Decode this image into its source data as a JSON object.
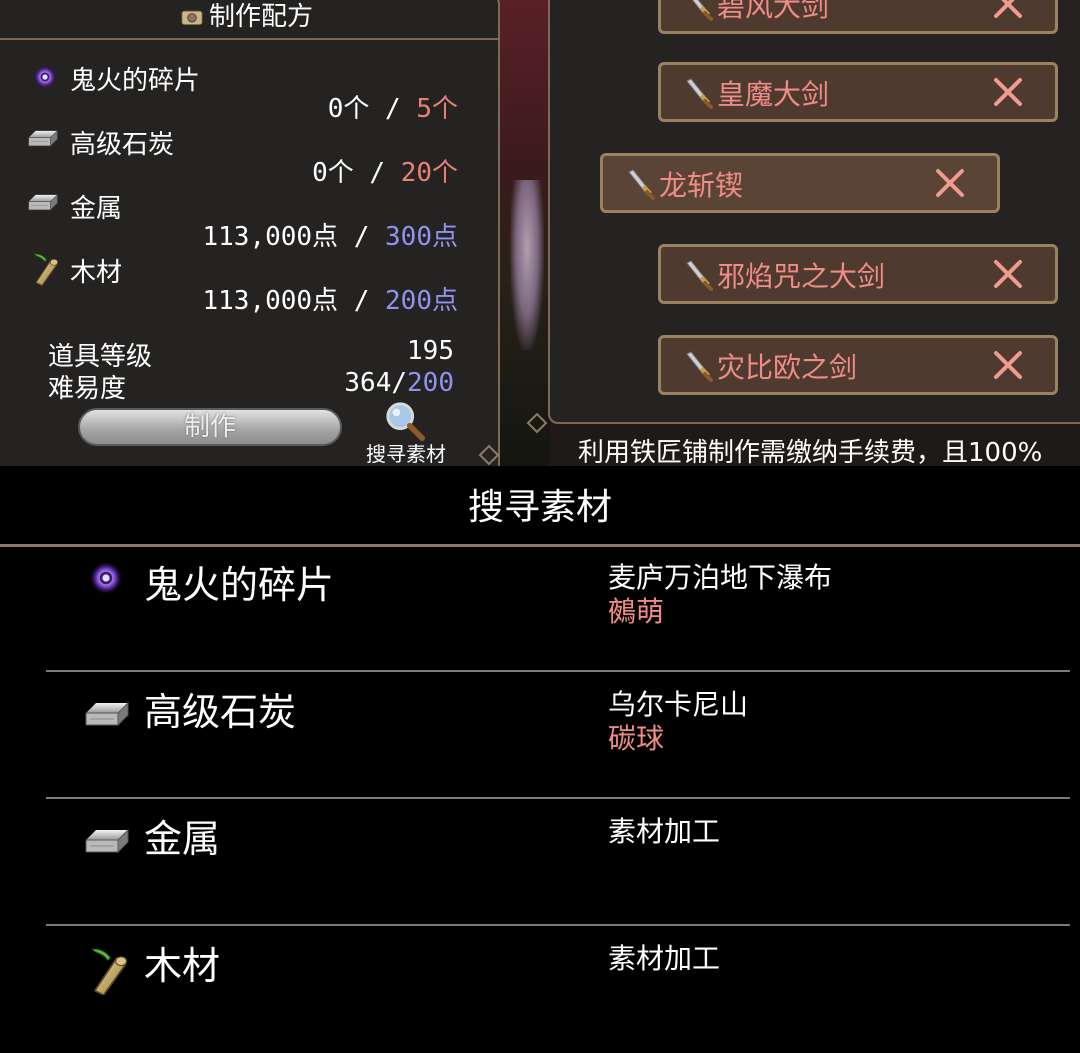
{
  "recipe": {
    "title": "制作配方",
    "materials": [
      {
        "name": "鬼火的碎片",
        "icon": "wisp-orb-icon",
        "have": "0个",
        "sep": " / ",
        "need": "5个",
        "need_color": "red"
      },
      {
        "name": "高级石炭",
        "icon": "coal-ingot-icon",
        "have": "0个",
        "sep": " / ",
        "need": "20个",
        "need_color": "red"
      },
      {
        "name": "金属",
        "icon": "metal-ingot-icon",
        "have": "113,000点",
        "sep": " / ",
        "need": "300点",
        "need_color": "blue"
      },
      {
        "name": "木材",
        "icon": "wood-log-icon",
        "have": "113,000点",
        "sep": " / ",
        "need": "200点",
        "need_color": "blue"
      }
    ],
    "item_level_label": "道具等级",
    "item_level_value": "195",
    "difficulty_label": "难易度",
    "difficulty_value": "364/",
    "difficulty_max": "200",
    "craft_button": "制作",
    "search_button": "搜寻素材"
  },
  "weapons": [
    {
      "name": "碧风大剑"
    },
    {
      "name": "皇魔大剑"
    },
    {
      "name": "龙斩锲",
      "selected": true
    },
    {
      "name": "邪焰咒之大剑"
    },
    {
      "name": "灾比欧之剑"
    }
  ],
  "notice": "利用铁匠铺制作需缴纳手续费，且100%",
  "search": {
    "title": "搜寻素材",
    "rows": [
      {
        "name": "鬼火的碎片",
        "icon": "wisp-orb-icon",
        "location": "麦庐万泊地下瀑布",
        "boss": "鵺萌"
      },
      {
        "name": "高级石炭",
        "icon": "coal-ingot-icon",
        "location": "乌尔卡尼山",
        "boss": "碳球"
      },
      {
        "name": "金属",
        "icon": "metal-ingot-icon",
        "location": "素材加工",
        "boss": ""
      },
      {
        "name": "木材",
        "icon": "wood-log-icon",
        "location": "素材加工",
        "boss": ""
      }
    ]
  },
  "colors": {
    "need_red": "#e88078",
    "need_blue": "#8f93ee",
    "weapon_text": "#ef8c86",
    "panel_border": "#7c6a53"
  }
}
